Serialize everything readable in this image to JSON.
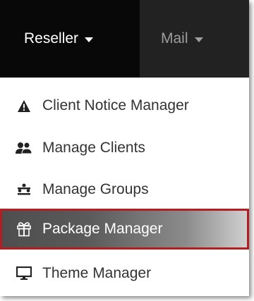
{
  "navbar": {
    "reseller_label": "Reseller",
    "mail_label": "Mail"
  },
  "menu": {
    "items": [
      {
        "label": "Client Notice Manager",
        "icon": "warning-icon"
      },
      {
        "label": "Manage Clients",
        "icon": "users-icon"
      },
      {
        "label": "Manage Groups",
        "icon": "groups-icon"
      },
      {
        "label": "Package Manager",
        "icon": "gift-icon",
        "active": true
      },
      {
        "label": "Theme Manager",
        "icon": "monitor-icon"
      }
    ]
  },
  "colors": {
    "navbar_bg": "#222222",
    "nav_active_bg": "#080808",
    "highlight_border": "#b11f24",
    "text": "#333333"
  }
}
